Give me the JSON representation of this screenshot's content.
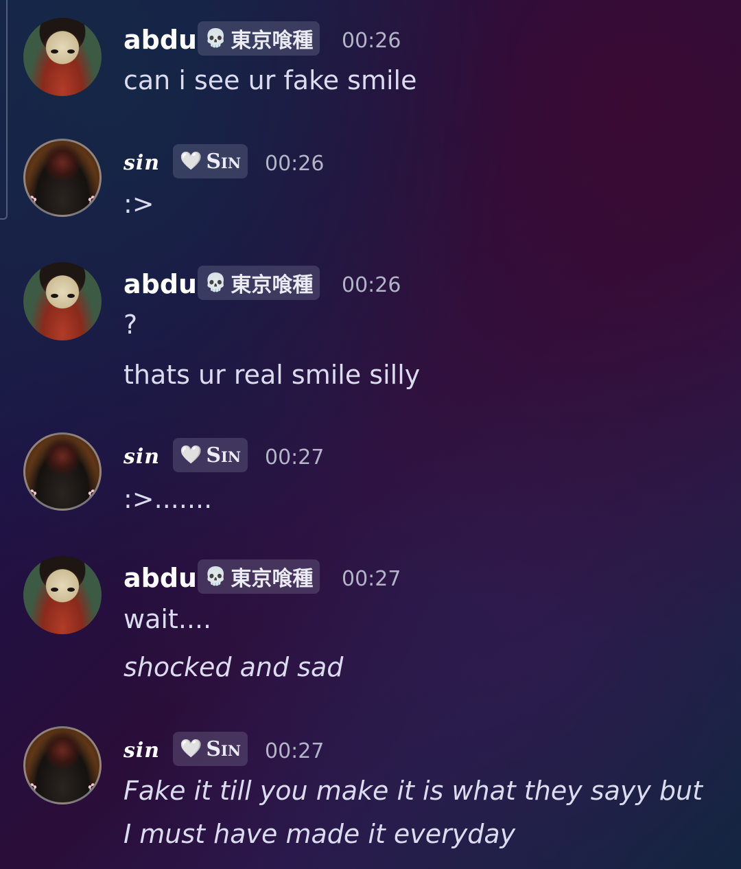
{
  "messages": [
    {
      "author": "abdu",
      "tag_icon": "skull-icon",
      "tag": "東京喰種",
      "time": "00:26",
      "lines": [
        "can i see ur fake smile"
      ]
    },
    {
      "author": "sin",
      "tag_icon": "heart-icon",
      "tag": "Sin",
      "time": "00:26",
      "lines": [
        ":>"
      ]
    },
    {
      "author": "abdu",
      "tag_icon": "skull-icon",
      "tag": "東京喰種",
      "time": "00:26",
      "lines": [
        "?",
        "thats ur real smile silly"
      ]
    },
    {
      "author": "sin",
      "tag_icon": "heart-icon",
      "tag": "Sin",
      "time": "00:27",
      "lines": [
        ":>......."
      ]
    },
    {
      "author": "abdu",
      "tag_icon": "skull-icon",
      "tag": "東京喰種",
      "time": "00:27",
      "lines": [
        "wait....",
        "shocked and sad"
      ]
    },
    {
      "author": "sin",
      "tag_icon": "heart-icon",
      "tag": "Sin",
      "time": "00:27",
      "lines": [
        "Fake it till you make it is what they sayy but",
        "I must have made it everyday"
      ]
    }
  ]
}
